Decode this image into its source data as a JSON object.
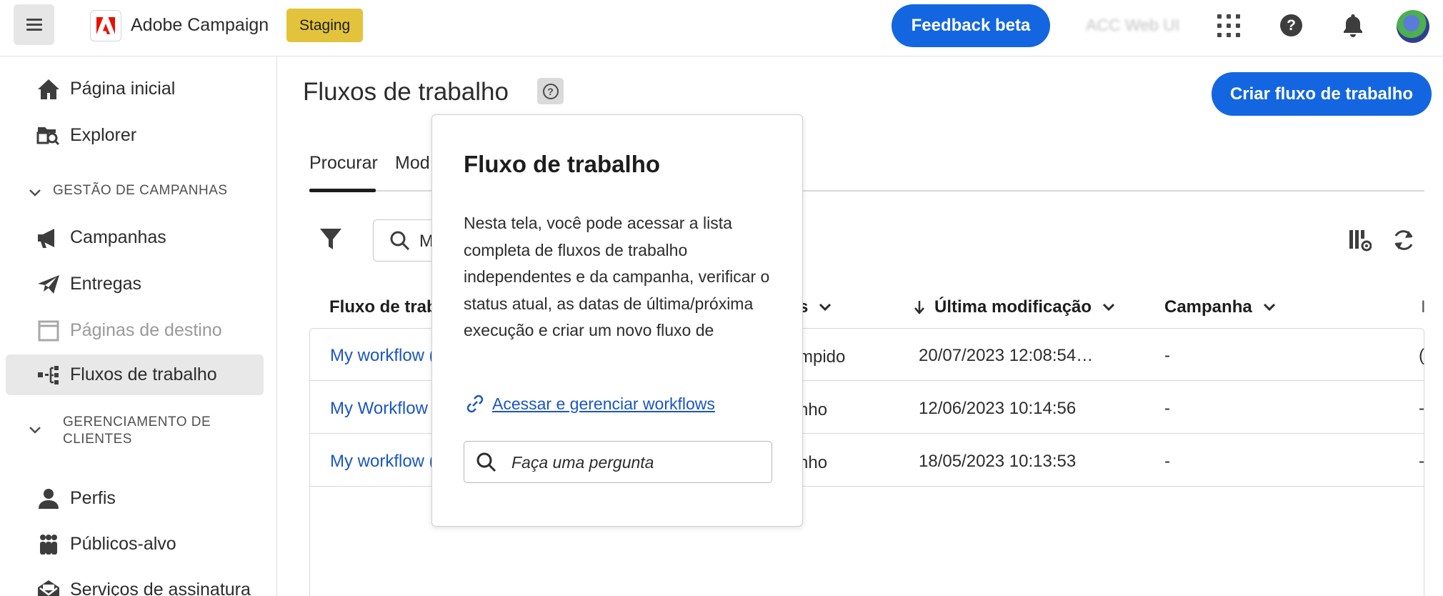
{
  "topbar": {
    "app_name": "Adobe Campaign",
    "env_badge": "Staging",
    "feedback_label": "Feedback beta",
    "org_name": "ACC Web UI"
  },
  "sidebar": {
    "items_top": [
      {
        "label": "Página inicial",
        "icon": "home-icon"
      },
      {
        "label": "Explorer",
        "icon": "explorer-icon"
      }
    ],
    "section1": "GESTÃO DE CAMPANHAS",
    "campaign_items": [
      {
        "label": "Campanhas",
        "icon": "megaphone-icon"
      },
      {
        "label": "Entregas",
        "icon": "send-icon"
      },
      {
        "label": "Páginas de destino",
        "icon": "landing-page-icon",
        "disabled": true
      },
      {
        "label": "Fluxos de trabalho",
        "icon": "workflow-icon",
        "active": true
      }
    ],
    "section2_line1": "GERENCIAMENTO DE",
    "section2_line2": "CLIENTES",
    "client_items": [
      {
        "label": "Perfis",
        "icon": "user-icon"
      },
      {
        "label": "Públicos-alvo",
        "icon": "audiences-icon"
      },
      {
        "label": "Serviços de assinatura",
        "icon": "subscription-icon"
      }
    ]
  },
  "main": {
    "title": "Fluxos de trabalho",
    "create_button": "Criar fluxo de trabalho",
    "tabs": [
      "Procurar",
      "Mod"
    ],
    "search_value": "M",
    "columns": {
      "workflow": "Fluxo de trab",
      "status": "s",
      "last_modified": "Última modificação",
      "campaign": "Campanha",
      "extra": "I"
    },
    "rows": [
      {
        "name": "My workflow (",
        "status": "mpido",
        "date": "20/07/2023  12:08:54…",
        "campaign": "-",
        "extra": "("
      },
      {
        "name": "My Workflow",
        "status": "nho",
        "date": "12/06/2023  10:14:56",
        "campaign": "-",
        "extra": "-"
      },
      {
        "name": "My workflow (",
        "status": "nho",
        "date": "18/05/2023  10:13:53",
        "campaign": "-",
        "extra": "-"
      }
    ]
  },
  "popover": {
    "title": "Fluxo de trabalho",
    "description": "Nesta tela, você pode acessar a lista completa de fluxos de trabalho independentes e da campanha, verificar o status  atual, as datas de última/próxima  execução e criar um novo fluxo de trabalho. Navegue até…",
    "link_label": "Acessar e gerenciar workflows",
    "search_placeholder": "Faça uma pergunta"
  },
  "colors": {
    "accent": "#1366e0",
    "staging": "#e2c33b",
    "link": "#1a56c2"
  }
}
